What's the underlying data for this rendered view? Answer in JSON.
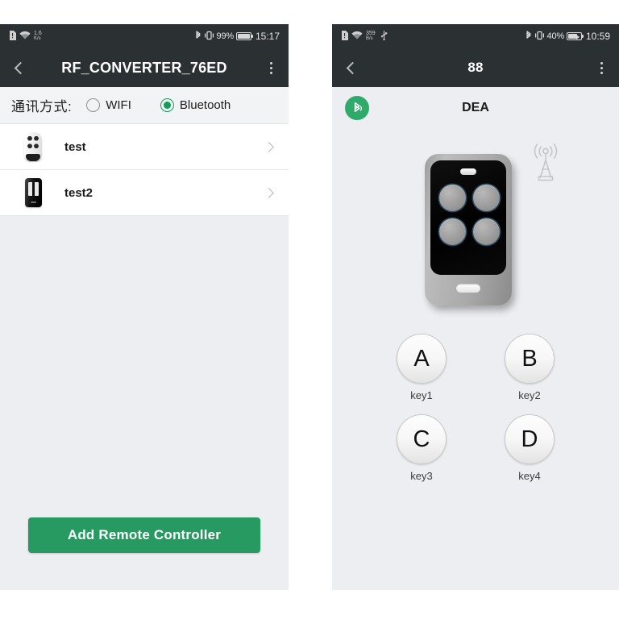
{
  "left_phone": {
    "statusbar": {
      "icons_left": [
        "sim-card-icon",
        "wifi-icon"
      ],
      "network_speed_value": "1.6",
      "network_speed_unit": "K/s",
      "icons_right": [
        "bluetooth-icon",
        "vibrate-icon"
      ],
      "battery_percent": "99%",
      "time": "15:17"
    },
    "appbar": {
      "back_icon": "chevron-left-icon",
      "title": "RF_CONVERTER_76ED",
      "menu_icon": "kebab-menu-icon"
    },
    "mode_row": {
      "label": "通讯方式:",
      "options": [
        {
          "label": "WIFI",
          "selected": false
        },
        {
          "label": "Bluetooth",
          "selected": true
        }
      ]
    },
    "devices": [
      {
        "name": "test",
        "icon": "white-remote-icon",
        "chevron": "chevron-right-icon"
      },
      {
        "name": "test2",
        "icon": "black-remote-icon",
        "chevron": "chevron-right-icon"
      }
    ],
    "footer": {
      "add_button_label": "Add Remote Controller"
    }
  },
  "right_phone": {
    "statusbar": {
      "icons_left": [
        "sim-card-icon",
        "wifi-icon",
        "usb-icon"
      ],
      "network_speed_value": "359",
      "network_speed_unit": "B/s",
      "icons_right": [
        "bluetooth-icon",
        "vibrate-icon"
      ],
      "battery_percent": "40%",
      "time": "10:59"
    },
    "appbar": {
      "back_icon": "chevron-left-icon",
      "title": "88",
      "menu_icon": "kebab-menu-icon"
    },
    "device_header": {
      "badge_icon": "bluetooth-badge-icon",
      "title": "DEA"
    },
    "remote_image": {
      "icon": "rf-remote-illustration",
      "antenna_icon": "radio-tower-icon"
    },
    "keys": [
      {
        "letter": "A",
        "label": "key1"
      },
      {
        "letter": "B",
        "label": "key2"
      },
      {
        "letter": "C",
        "label": "key3"
      },
      {
        "letter": "D",
        "label": "key4"
      }
    ]
  },
  "colors": {
    "accent_green": "#269a61",
    "badge_green": "#2faa6b",
    "radio_green": "#0f9d58",
    "statusbar_dark": "#2b3033",
    "panel_bg": "#eceef1"
  }
}
